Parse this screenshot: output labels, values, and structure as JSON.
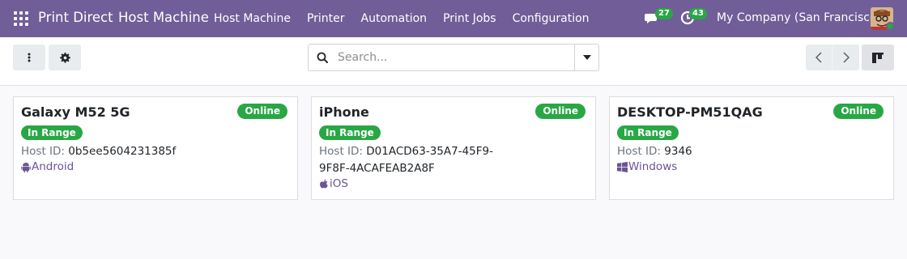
{
  "navbar": {
    "app_name": "Print Direct",
    "section_title": "Host Machine",
    "menu": [
      "Host Machine",
      "Printer",
      "Automation",
      "Print Jobs",
      "Configuration"
    ],
    "messages_count": "27",
    "activities_count": "43",
    "company": "My Company (San Francisco)",
    "icons": [
      "apps-grid-icon",
      "chat-icon",
      "clock-icon",
      "avatar"
    ]
  },
  "control_panel": {
    "search_placeholder": "Search...",
    "icons": [
      "more-vertical-icon",
      "gear-icon",
      "search-icon",
      "caret-down-icon",
      "chevron-left-icon",
      "chevron-right-icon",
      "kanban-view-icon"
    ]
  },
  "cards": [
    {
      "name": "Galaxy M52 5G",
      "status": "Online",
      "range": "In Range",
      "host_label": "Host ID:",
      "host_id": "0b5ee5604231385f",
      "os": "Android",
      "os_icon": "android-icon"
    },
    {
      "name": "iPhone",
      "status": "Online",
      "range": "In Range",
      "host_label": "Host ID:",
      "host_id": "D01ACD63-35A7-45F9-9F8F-4ACAFEAB2A8F",
      "os": "iOS",
      "os_icon": "apple-icon"
    },
    {
      "name": "DESKTOP-PM51QAG",
      "status": "Online",
      "range": "In Range",
      "host_label": "Host ID:",
      "host_id": "9346",
      "os": "Windows",
      "os_icon": "windows-icon"
    }
  ],
  "colors": {
    "navbar": "#715d98",
    "success": "#28a745",
    "os_text": "#6a5497"
  }
}
